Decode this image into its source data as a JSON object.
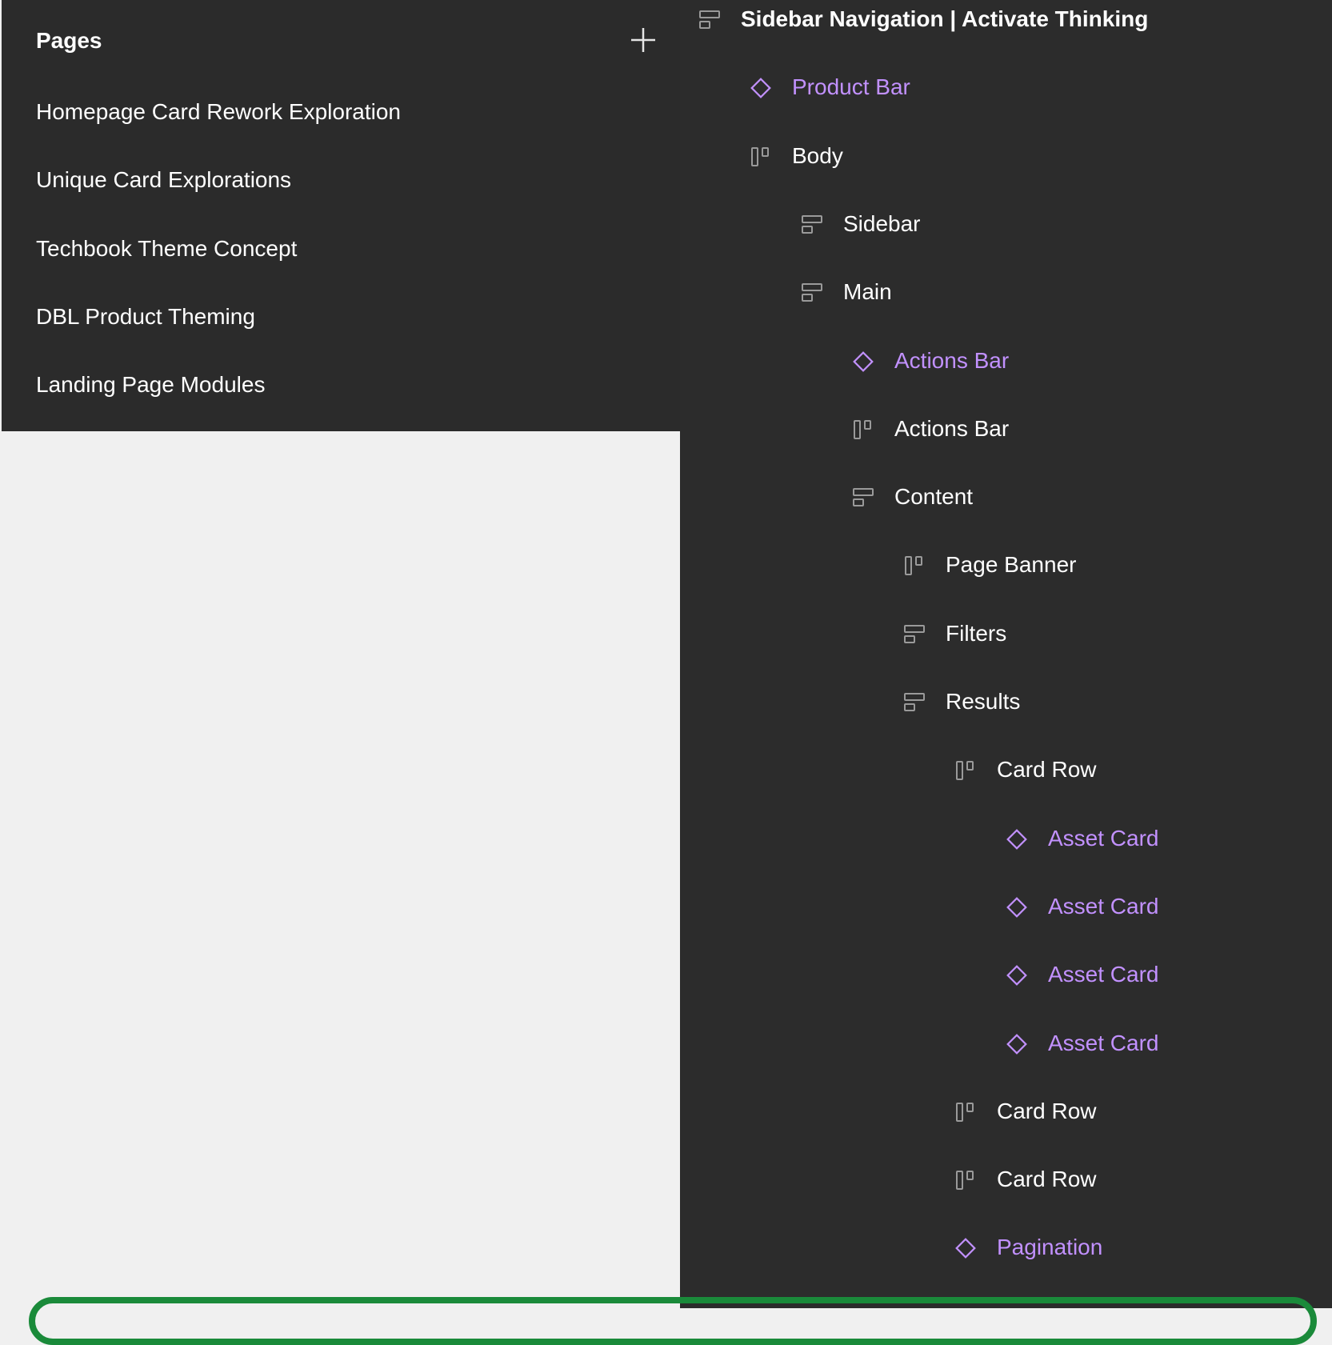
{
  "pages_panel": {
    "title": "Pages",
    "add_icon": "plus-icon",
    "items": [
      {
        "label": "Homepage Card Rework Exploration"
      },
      {
        "label": "Unique Card Explorations"
      },
      {
        "label": "Techbook Theme Concept"
      },
      {
        "label": "DBL Product Theming"
      },
      {
        "label": "Landing Page Modules"
      }
    ]
  },
  "layers_panel": {
    "colors": {
      "component_text": "#c291ff",
      "frame_text": "#ffffff",
      "icon_gray": "#9a9a9a",
      "background": "#2c2c2c"
    },
    "layers": [
      {
        "label": "Sidebar Navigation | Activate Thinking",
        "icon": "vertical-auto-layout-icon",
        "type": "frame",
        "depth": 0
      },
      {
        "label": "Product Bar",
        "icon": "component-instance-icon",
        "type": "component",
        "depth": 1
      },
      {
        "label": "Body",
        "icon": "horizontal-auto-layout-icon",
        "type": "frame",
        "depth": 1
      },
      {
        "label": "Sidebar",
        "icon": "vertical-auto-layout-icon",
        "type": "frame",
        "depth": 2
      },
      {
        "label": "Main",
        "icon": "vertical-auto-layout-icon",
        "type": "frame",
        "depth": 2
      },
      {
        "label": "Actions Bar",
        "icon": "component-instance-icon",
        "type": "component",
        "depth": 3
      },
      {
        "label": "Actions Bar",
        "icon": "horizontal-auto-layout-icon",
        "type": "frame",
        "depth": 3
      },
      {
        "label": "Content",
        "icon": "vertical-auto-layout-icon",
        "type": "frame",
        "depth": 3
      },
      {
        "label": "Page Banner",
        "icon": "horizontal-auto-layout-icon",
        "type": "frame",
        "depth": 4
      },
      {
        "label": "Filters",
        "icon": "vertical-auto-layout-icon",
        "type": "frame",
        "depth": 4
      },
      {
        "label": "Results",
        "icon": "vertical-auto-layout-icon",
        "type": "frame",
        "depth": 4
      },
      {
        "label": "Card Row",
        "icon": "horizontal-auto-layout-icon",
        "type": "frame",
        "depth": 5
      },
      {
        "label": "Asset Card",
        "icon": "component-instance-icon",
        "type": "component",
        "depth": 6
      },
      {
        "label": "Asset Card",
        "icon": "component-instance-icon",
        "type": "component",
        "depth": 6
      },
      {
        "label": "Asset Card",
        "icon": "component-instance-icon",
        "type": "component",
        "depth": 6
      },
      {
        "label": "Asset Card",
        "icon": "component-instance-icon",
        "type": "component",
        "depth": 6
      },
      {
        "label": "Card Row",
        "icon": "horizontal-auto-layout-icon",
        "type": "frame",
        "depth": 5
      },
      {
        "label": "Card Row",
        "icon": "horizontal-auto-layout-icon",
        "type": "frame",
        "depth": 5
      },
      {
        "label": "Pagination",
        "icon": "component-instance-icon",
        "type": "component",
        "depth": 5
      }
    ]
  }
}
